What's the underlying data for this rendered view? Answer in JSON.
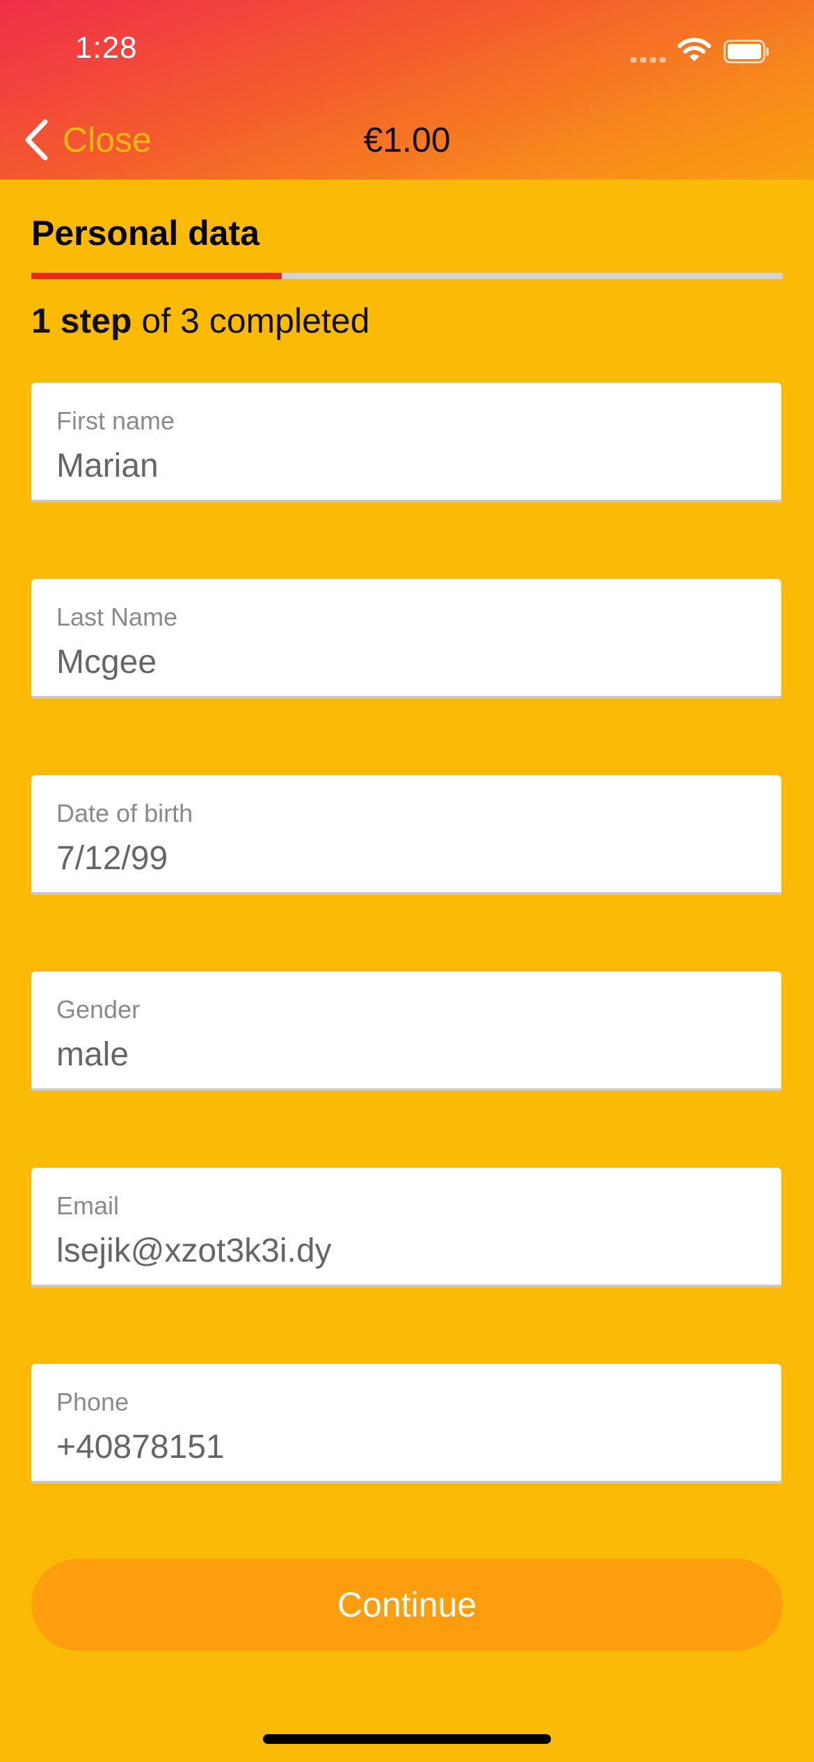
{
  "status_bar": {
    "time": "1:28",
    "icons": [
      "cellular-signal-icon",
      "wifi-icon",
      "battery-icon"
    ]
  },
  "nav": {
    "back_label": "Close",
    "back_icon": "chevron-left-icon",
    "title": "€1.00"
  },
  "section": {
    "title": "Personal data"
  },
  "progress": {
    "completed_steps": 1,
    "total_steps": 3,
    "fraction": 0.333,
    "step_strong": "1 step",
    "step_rest": " of 3 completed"
  },
  "fields": [
    {
      "label": "First name",
      "value": "Marian"
    },
    {
      "label": "Last Name",
      "value": "Mcgee"
    },
    {
      "label": "Date of birth",
      "value": "7/12/99"
    },
    {
      "label": "Gender",
      "value": "male"
    },
    {
      "label": "Email",
      "value": "lsejik@xzot3k3i.dy"
    },
    {
      "label": "Phone",
      "value": "+40878151"
    }
  ],
  "actions": {
    "continue_label": "Continue"
  },
  "colors": {
    "background": "#FBBA05",
    "header_gradient_start": "#F02D4A",
    "header_gradient_end": "#F9A010",
    "accent_back": "#FDB813",
    "progress_fill": "#E82B12",
    "progress_track": "#D4D4CC",
    "button": "#FE9D0E"
  }
}
